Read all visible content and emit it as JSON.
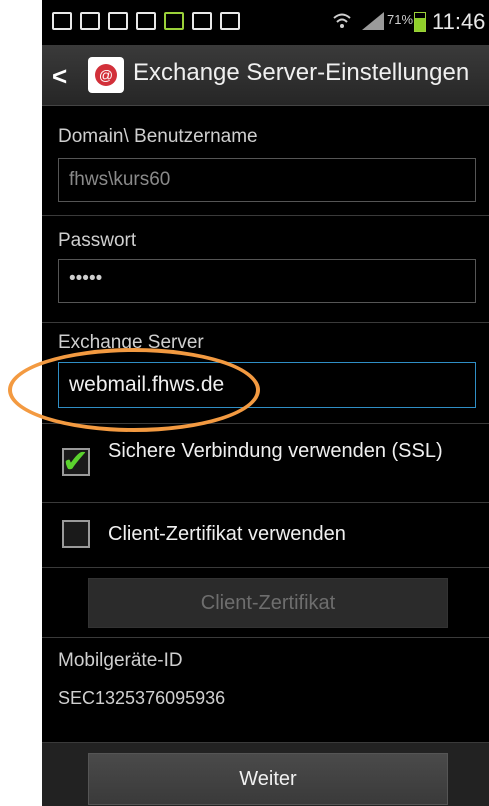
{
  "status_bar": {
    "battery_text": "71%",
    "battery_level": 0.71,
    "time": "11:46",
    "icons": [
      "notification-icon",
      "image-icon",
      "calendar-icon",
      "mail-icon",
      "settings-icon",
      "check-icon",
      "download-icon",
      "wifi-icon",
      "signal-icon"
    ]
  },
  "header": {
    "title": "Exchange Server-Einstellungen",
    "app_icon_symbol": "@"
  },
  "form": {
    "domain_label": "Domain\\ Benutzername",
    "domain_value": "fhws\\kurs60",
    "password_label": "Passwort",
    "password_value": "•••••",
    "server_label": "Exchange Server",
    "server_value": "webmail.fhws.de",
    "ssl_label": "Sichere Verbindung verwenden (SSL)",
    "ssl_checked": true,
    "client_cert_label": "Client-Zertifikat verwenden",
    "client_cert_checked": false,
    "client_cert_button": "Client-Zertifikat",
    "device_id_label": "Mobilgeräte-ID",
    "device_id_value": "SEC1325376095936"
  },
  "footer": {
    "next_button": "Weiter"
  },
  "colors": {
    "accent": "#2f8ec5",
    "check": "#5bd22e",
    "highlight": "#f39a41",
    "battery": "#8fcf2a"
  }
}
